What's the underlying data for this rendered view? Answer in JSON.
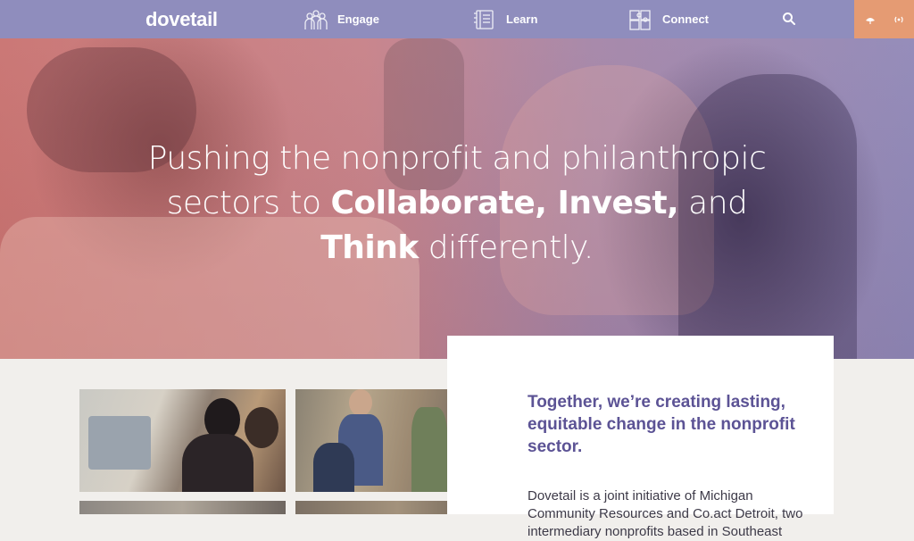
{
  "nav": {
    "logo": "dovetail",
    "items": [
      {
        "label": "Engage",
        "icon": "people-group-icon"
      },
      {
        "label": "Learn",
        "icon": "book-icon"
      },
      {
        "label": "Connect",
        "icon": "puzzle-icon"
      }
    ],
    "search_icon": "search-icon",
    "social_icons": [
      "leaf-icon",
      "signal-icon"
    ],
    "colors": {
      "bar": "#8f8dbd",
      "social": "#e59b73"
    }
  },
  "hero": {
    "line1": "Pushing the nonprofit and philanthropic",
    "line2_pre": "sectors to ",
    "line2_bold": "Collaborate, Invest,",
    "line2_post": " and",
    "line3_bold": "Think",
    "line3_post": " differently."
  },
  "intro": {
    "heading": "Together, we’re creating lasting, equitable change in the nonprofit sector.",
    "body": "Dovetail is a joint initiative of Michigan Community Resources and Co.act Detroit, two intermediary nonprofits based in Southeast",
    "heading_color": "#5c5395"
  }
}
